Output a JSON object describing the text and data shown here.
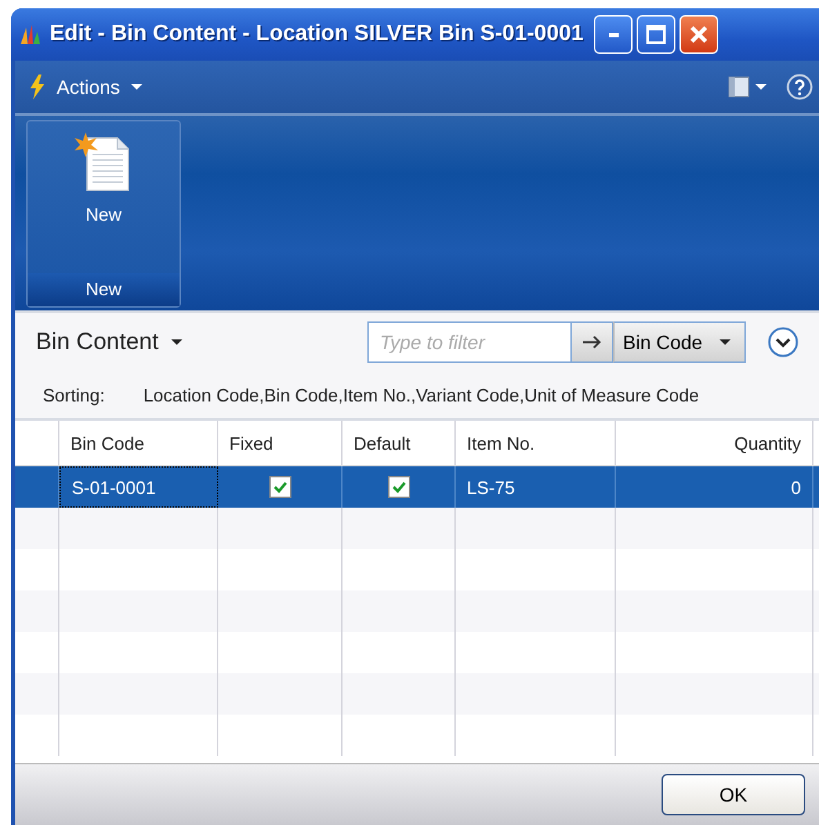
{
  "window": {
    "title": "Edit - Bin Content - Location SILVER Bin S-01-0001"
  },
  "toolbar": {
    "actions_label": "Actions"
  },
  "ribbon": {
    "groups": [
      {
        "label": "New",
        "actions": [
          {
            "label": "New"
          }
        ]
      }
    ]
  },
  "list": {
    "title": "Bin Content",
    "filter": {
      "placeholder": "Type to filter",
      "field": "Bin Code"
    },
    "sorting_label": "Sorting:",
    "sorting": "Location Code,Bin Code,Item No.,Variant Code,Unit of Measure Code"
  },
  "table": {
    "columns": [
      {
        "label": "Bin Code",
        "kind": "text"
      },
      {
        "label": "Fixed",
        "kind": "check"
      },
      {
        "label": "Default",
        "kind": "check"
      },
      {
        "label": "Item No.",
        "kind": "text"
      },
      {
        "label": "Quantity",
        "kind": "number"
      }
    ],
    "rows": [
      {
        "selected": true,
        "cells": [
          {
            "value": "S-01-0001"
          },
          {
            "checked": true
          },
          {
            "checked": true
          },
          {
            "value": "LS-75"
          },
          {
            "value": "0"
          }
        ]
      }
    ]
  },
  "buttons": [
    "OK"
  ]
}
